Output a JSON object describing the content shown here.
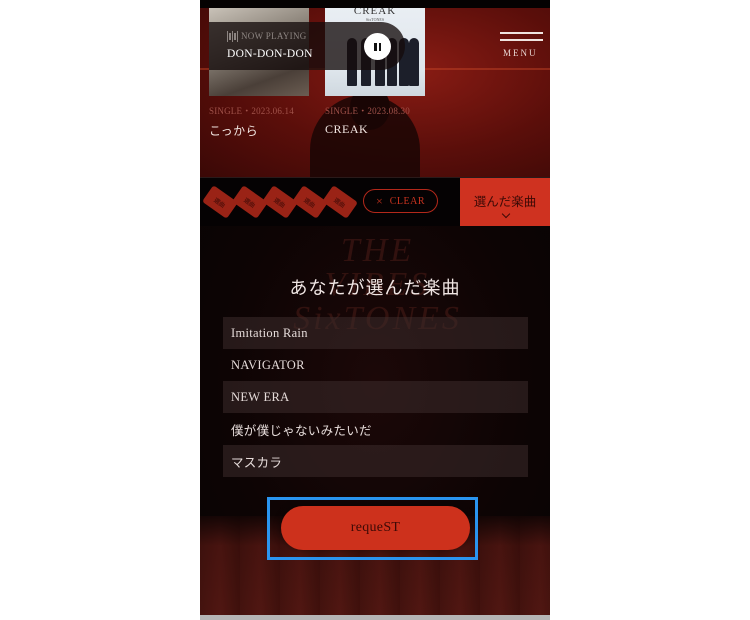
{
  "now_playing": {
    "label": "NOW PLAYING",
    "track": "DON-DON-DON",
    "control_icon": "pause-icon"
  },
  "menu": {
    "label": "MENU",
    "icon": "hamburger-icon"
  },
  "albums": [
    {
      "meta": "SINGLE・2023.06.14",
      "title": "こっから"
    },
    {
      "meta": "SINGLE・2023.08.30",
      "title": "CREAK",
      "art_title": "CREAK",
      "art_sub": "SixTONES"
    }
  ],
  "ticket_bar": {
    "tickets": [
      {
        "label": "選曲"
      },
      {
        "label": "選曲"
      },
      {
        "label": "選曲"
      },
      {
        "label": "選曲"
      },
      {
        "label": "選曲"
      }
    ],
    "clear_icon": "×",
    "clear_label": "CLEAR",
    "selected_tab_label": "選んだ楽曲"
  },
  "main": {
    "background_logo": "THE VIBES SixTONES",
    "heading": "あなたが選んだ楽曲",
    "songs": [
      "Imitation Rain",
      "NAVIGATOR",
      "NEW ERA",
      "僕が僕じゃないみたいだ",
      "マスカラ"
    ],
    "request_label": "requeST"
  },
  "colors": {
    "accent": "#cf3220",
    "focus": "#2a95f0",
    "background": "#0a0404"
  }
}
